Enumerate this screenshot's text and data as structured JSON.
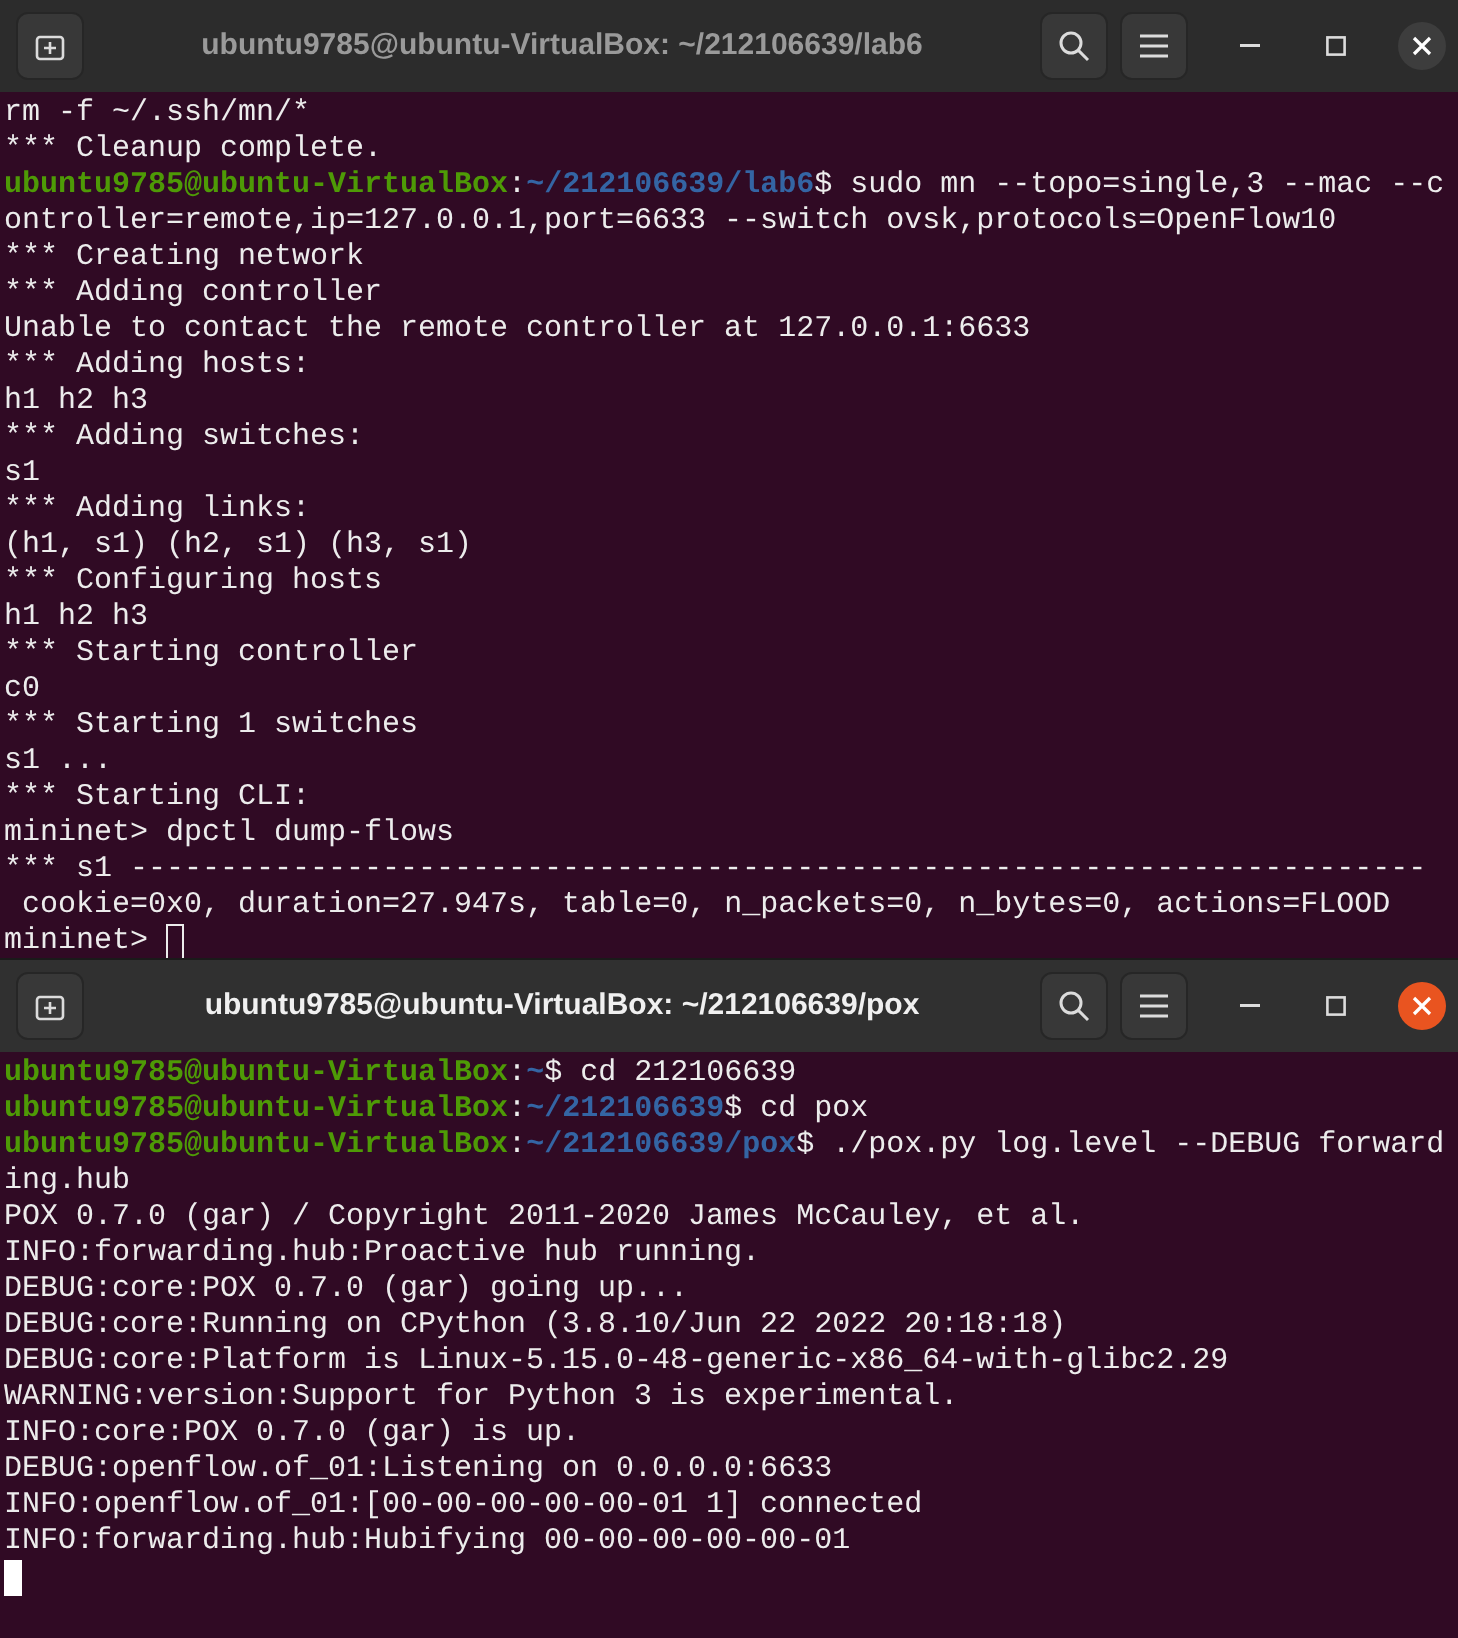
{
  "windows": [
    {
      "title": "ubuntu9785@ubuntu-VirtualBox: ~/212106639/lab6",
      "focused": false,
      "lines": [
        {
          "kind": "output",
          "text": "rm -f ~/.ssh/mn/*"
        },
        {
          "kind": "output",
          "text": "*** Cleanup complete."
        },
        {
          "kind": "prompt",
          "user": "ubuntu9785@ubuntu-VirtualBox",
          "separator": ":",
          "path": "~/212106639/lab6",
          "symbol": "$",
          "command": " sudo mn --topo=single,3 --mac --controller=remote,ip=127.0.0.1,port=6633 --switch ovsk,protocols=OpenFlow10"
        },
        {
          "kind": "output",
          "text": "*** Creating network"
        },
        {
          "kind": "output",
          "text": "*** Adding controller"
        },
        {
          "kind": "output",
          "text": "Unable to contact the remote controller at 127.0.0.1:6633"
        },
        {
          "kind": "output",
          "text": "*** Adding hosts:"
        },
        {
          "kind": "output",
          "text": "h1 h2 h3"
        },
        {
          "kind": "output",
          "text": "*** Adding switches:"
        },
        {
          "kind": "output",
          "text": "s1"
        },
        {
          "kind": "output",
          "text": "*** Adding links:"
        },
        {
          "kind": "output",
          "text": "(h1, s1) (h2, s1) (h3, s1)"
        },
        {
          "kind": "output",
          "text": "*** Configuring hosts"
        },
        {
          "kind": "output",
          "text": "h1 h2 h3"
        },
        {
          "kind": "output",
          "text": "*** Starting controller"
        },
        {
          "kind": "output",
          "text": "c0"
        },
        {
          "kind": "output",
          "text": "*** Starting 1 switches"
        },
        {
          "kind": "output",
          "text": "s1 ..."
        },
        {
          "kind": "output",
          "text": "*** Starting CLI:"
        },
        {
          "kind": "output",
          "text": "mininet> dpctl dump-flows"
        },
        {
          "kind": "output",
          "text": "*** s1 ------------------------------------------------------------------------"
        },
        {
          "kind": "output",
          "text": " cookie=0x0, duration=27.947s, table=0, n_packets=0, n_bytes=0, actions=FLOOD"
        },
        {
          "kind": "cursor",
          "text": "mininet> "
        }
      ]
    },
    {
      "title": "ubuntu9785@ubuntu-VirtualBox: ~/212106639/pox",
      "focused": true,
      "lines": [
        {
          "kind": "prompt",
          "user": "ubuntu9785@ubuntu-VirtualBox",
          "separator": ":",
          "path": "~",
          "symbol": "$",
          "command": " cd 212106639"
        },
        {
          "kind": "prompt",
          "user": "ubuntu9785@ubuntu-VirtualBox",
          "separator": ":",
          "path": "~/212106639",
          "symbol": "$",
          "command": " cd pox"
        },
        {
          "kind": "prompt",
          "user": "ubuntu9785@ubuntu-VirtualBox",
          "separator": ":",
          "path": "~/212106639/pox",
          "symbol": "$",
          "command": " ./pox.py log.level --DEBUG forwarding.hub"
        },
        {
          "kind": "output",
          "text": "POX 0.7.0 (gar) / Copyright 2011-2020 James McCauley, et al."
        },
        {
          "kind": "output",
          "text": "INFO:forwarding.hub:Proactive hub running."
        },
        {
          "kind": "output",
          "text": "DEBUG:core:POX 0.7.0 (gar) going up..."
        },
        {
          "kind": "output",
          "text": "DEBUG:core:Running on CPython (3.8.10/Jun 22 2022 20:18:18)"
        },
        {
          "kind": "output",
          "text": "DEBUG:core:Platform is Linux-5.15.0-48-generic-x86_64-with-glibc2.29"
        },
        {
          "kind": "output",
          "text": "WARNING:version:Support for Python 3 is experimental."
        },
        {
          "kind": "output",
          "text": "INFO:core:POX 0.7.0 (gar) is up."
        },
        {
          "kind": "output",
          "text": "DEBUG:openflow.of_01:Listening on 0.0.0.0:6633"
        },
        {
          "kind": "output",
          "text": "INFO:openflow.of_01:[00-00-00-00-00-01 1] connected"
        },
        {
          "kind": "output",
          "text": "INFO:forwarding.hub:Hubifying 00-00-00-00-00-01"
        },
        {
          "kind": "cursor"
        }
      ]
    }
  ]
}
